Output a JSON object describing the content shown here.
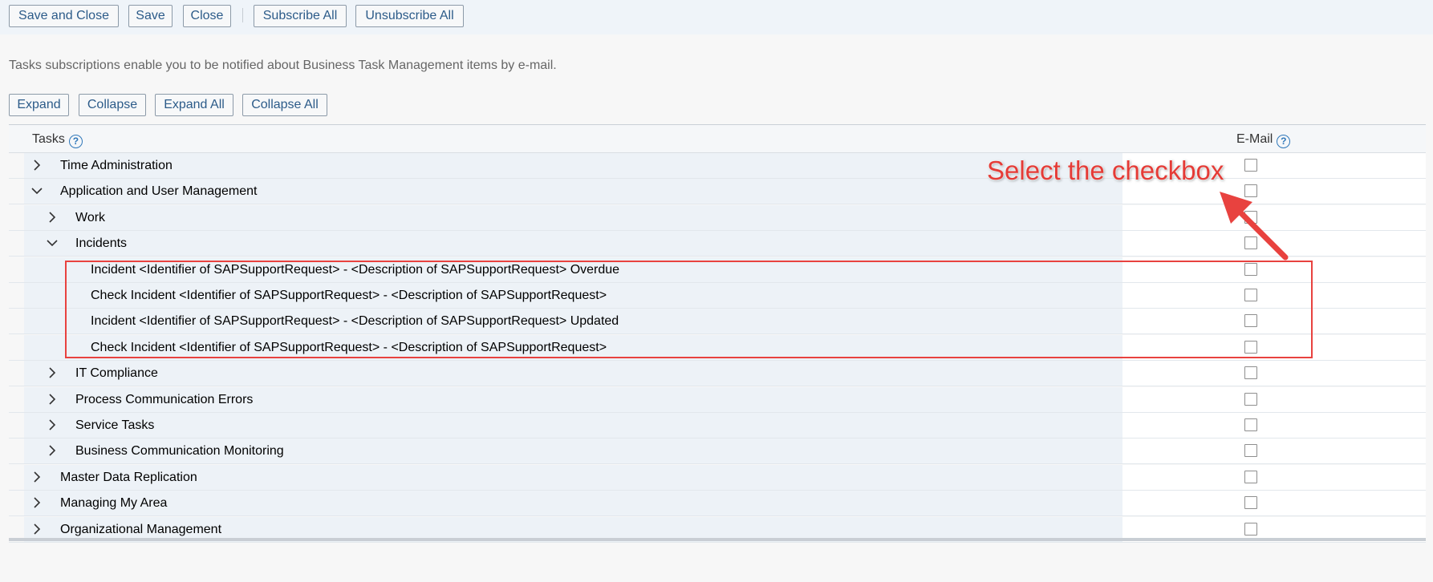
{
  "toolbar": {
    "save_close": "Save and Close",
    "save": "Save",
    "close": "Close",
    "subscribe_all": "Subscribe All",
    "unsubscribe_all": "Unsubscribe All"
  },
  "info_text": "Tasks subscriptions enable you to be notified about Business Task Management items by e-mail.",
  "tree_toolbar": {
    "expand": "Expand",
    "collapse": "Collapse",
    "expand_all": "Expand All",
    "collapse_all": "Collapse All"
  },
  "table": {
    "col_tasks": "Tasks",
    "col_email": "E-Mail",
    "help_glyph": "?",
    "rows": [
      {
        "label": "Time Administration",
        "level": 0,
        "state": "collapsed",
        "email": false
      },
      {
        "label": "Application and User Management",
        "level": 0,
        "state": "expanded",
        "email": false
      },
      {
        "label": "Work",
        "level": 1,
        "state": "collapsed",
        "email": false
      },
      {
        "label": "Incidents",
        "level": 1,
        "state": "expanded",
        "email": false
      },
      {
        "label": "Incident <Identifier of SAPSupportRequest> - <Description of SAPSupportRequest> Overdue",
        "level": 2,
        "state": "leaf",
        "email": false
      },
      {
        "label": "Check Incident <Identifier of SAPSupportRequest> - <Description of SAPSupportRequest>",
        "level": 2,
        "state": "leaf",
        "email": false
      },
      {
        "label": "Incident <Identifier of SAPSupportRequest> - <Description of SAPSupportRequest> Updated",
        "level": 2,
        "state": "leaf",
        "email": false
      },
      {
        "label": "Check Incident <Identifier of SAPSupportRequest> - <Description of SAPSupportRequest>",
        "level": 2,
        "state": "leaf",
        "email": false
      },
      {
        "label": "IT Compliance",
        "level": 1,
        "state": "collapsed",
        "email": false
      },
      {
        "label": "Process Communication Errors",
        "level": 1,
        "state": "collapsed",
        "email": false
      },
      {
        "label": "Service Tasks",
        "level": 1,
        "state": "collapsed",
        "email": false
      },
      {
        "label": "Business Communication Monitoring",
        "level": 1,
        "state": "collapsed",
        "email": false
      },
      {
        "label": "Master Data Replication",
        "level": 0,
        "state": "collapsed",
        "email": false
      },
      {
        "label": "Managing My Area",
        "level": 0,
        "state": "collapsed",
        "email": false
      },
      {
        "label": "Organizational Management",
        "level": 0,
        "state": "collapsed",
        "email": false
      }
    ]
  },
  "annotation": {
    "callout_text": "Select the checkbox",
    "color": "#e8423f"
  }
}
